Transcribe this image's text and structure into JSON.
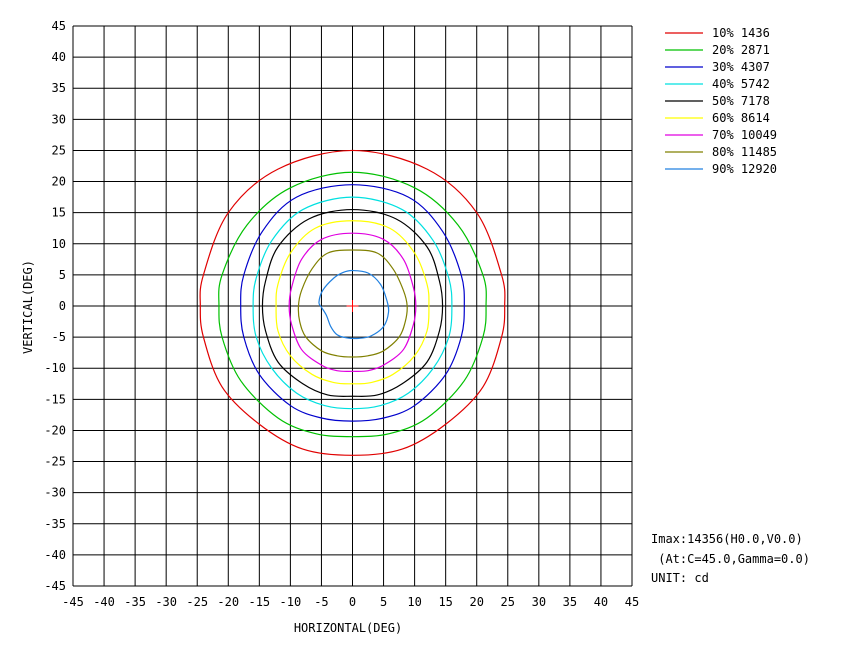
{
  "chart_data": {
    "type": "contour",
    "xlabel": "HORIZONTAL(DEG)",
    "ylabel": "VERTICAL(DEG)",
    "xlim": [
      -45,
      45
    ],
    "ylim": [
      -45,
      45
    ],
    "x_ticks": [
      -45,
      -40,
      -35,
      -30,
      -25,
      -20,
      -15,
      -10,
      -5,
      0,
      5,
      10,
      15,
      20,
      25,
      30,
      35,
      40,
      45
    ],
    "y_ticks": [
      45,
      40,
      35,
      30,
      25,
      20,
      15,
      10,
      5,
      0,
      -5,
      -10,
      -15,
      -20,
      -25,
      -30,
      -35,
      -40,
      -45
    ],
    "grid": true,
    "legend_position": "top-right",
    "center_marker": {
      "h": 0,
      "v": 0,
      "color": "#ff0000"
    },
    "series": [
      {
        "name": "10% 1436",
        "color": "#e00000",
        "points": [
          [
            0,
            25
          ],
          [
            12,
            22
          ],
          [
            20,
            15
          ],
          [
            24,
            5
          ],
          [
            24.5,
            0
          ],
          [
            24,
            -5
          ],
          [
            21,
            -13
          ],
          [
            15,
            -19
          ],
          [
            8,
            -23
          ],
          [
            0,
            -24
          ],
          [
            -8,
            -23
          ],
          [
            -15,
            -19
          ],
          [
            -21,
            -13
          ],
          [
            -24,
            -5
          ],
          [
            -24.5,
            0
          ],
          [
            -24,
            5
          ],
          [
            -20,
            15
          ],
          [
            -12,
            22
          ]
        ]
      },
      {
        "name": "20% 2871",
        "color": "#00c000",
        "points": [
          [
            0,
            21.5
          ],
          [
            10,
            19
          ],
          [
            17,
            13
          ],
          [
            21,
            5
          ],
          [
            21.5,
            0
          ],
          [
            21,
            -5
          ],
          [
            18,
            -12
          ],
          [
            12,
            -18
          ],
          [
            6,
            -20.5
          ],
          [
            0,
            -21
          ],
          [
            -6,
            -20.5
          ],
          [
            -12,
            -18
          ],
          [
            -18,
            -12
          ],
          [
            -21,
            -5
          ],
          [
            -21.5,
            0
          ],
          [
            -21,
            5
          ],
          [
            -17,
            13
          ],
          [
            -10,
            19
          ]
        ]
      },
      {
        "name": "30% 4307",
        "color": "#0000cc",
        "points": [
          [
            0,
            19.5
          ],
          [
            9,
            17.5
          ],
          [
            14.5,
            12
          ],
          [
            17.5,
            5
          ],
          [
            18,
            0
          ],
          [
            17.5,
            -5
          ],
          [
            15,
            -11
          ],
          [
            10,
            -16
          ],
          [
            5,
            -18
          ],
          [
            0,
            -18.5
          ],
          [
            -5,
            -18
          ],
          [
            -10,
            -16
          ],
          [
            -15,
            -11
          ],
          [
            -17.5,
            -5
          ],
          [
            -18,
            0
          ],
          [
            -17.5,
            5
          ],
          [
            -14.5,
            12
          ],
          [
            -9,
            17.5
          ]
        ]
      },
      {
        "name": "40% 5742",
        "color": "#00e0e0",
        "points": [
          [
            0,
            17.5
          ],
          [
            8,
            15.5
          ],
          [
            13,
            10.5
          ],
          [
            15.5,
            4.5
          ],
          [
            16,
            0
          ],
          [
            15.5,
            -5
          ],
          [
            13,
            -10
          ],
          [
            9,
            -14
          ],
          [
            4.5,
            -16
          ],
          [
            0,
            -16.5
          ],
          [
            -4.5,
            -16
          ],
          [
            -9,
            -14
          ],
          [
            -13,
            -10
          ],
          [
            -15.5,
            -5
          ],
          [
            -16,
            0
          ],
          [
            -15.5,
            4.5
          ],
          [
            -13,
            10.5
          ],
          [
            -8,
            15.5
          ]
        ]
      },
      {
        "name": "50% 7178",
        "color": "#000000",
        "points": [
          [
            0,
            15.5
          ],
          [
            7,
            14
          ],
          [
            12,
            9.5
          ],
          [
            14,
            4
          ],
          [
            14.5,
            0
          ],
          [
            14,
            -4
          ],
          [
            12,
            -9
          ],
          [
            8,
            -12.5
          ],
          [
            4,
            -14.3
          ],
          [
            0,
            -14.5
          ],
          [
            -4,
            -14.3
          ],
          [
            -8,
            -12.5
          ],
          [
            -12,
            -9
          ],
          [
            -14,
            -4
          ],
          [
            -14.5,
            0
          ],
          [
            -14,
            4
          ],
          [
            -12,
            9.5
          ],
          [
            -7,
            14
          ]
        ]
      },
      {
        "name": "60% 8614",
        "color": "#ffff00",
        "points": [
          [
            0,
            13.7
          ],
          [
            6,
            12.5
          ],
          [
            10,
            8.5
          ],
          [
            12,
            3.5
          ],
          [
            12.3,
            0
          ],
          [
            12,
            -4
          ],
          [
            10,
            -8
          ],
          [
            6.5,
            -11
          ],
          [
            3,
            -12.3
          ],
          [
            0,
            -12.5
          ],
          [
            -3,
            -12.3
          ],
          [
            -6.5,
            -11
          ],
          [
            -10,
            -8
          ],
          [
            -12,
            -4
          ],
          [
            -12.3,
            0
          ],
          [
            -12,
            3.5
          ],
          [
            -10,
            8.5
          ],
          [
            -6,
            12.5
          ]
        ]
      },
      {
        "name": "70% 10049",
        "color": "#e000e0",
        "points": [
          [
            0,
            11.7
          ],
          [
            5,
            10.7
          ],
          [
            8.2,
            7.5
          ],
          [
            9.8,
            3
          ],
          [
            10.2,
            0
          ],
          [
            9.8,
            -3
          ],
          [
            8.2,
            -7
          ],
          [
            5,
            -9.5
          ],
          [
            2.5,
            -10.4
          ],
          [
            0,
            -10.5
          ],
          [
            -2.5,
            -10.4
          ],
          [
            -5,
            -9.5
          ],
          [
            -8.2,
            -7
          ],
          [
            -9.8,
            -3
          ],
          [
            -10.2,
            0
          ],
          [
            -9.8,
            3
          ],
          [
            -8.2,
            7.5
          ],
          [
            -5,
            10.7
          ]
        ]
      },
      {
        "name": "80% 11485",
        "color": "#808000",
        "points": [
          [
            0,
            9
          ],
          [
            4,
            8.5
          ],
          [
            6.5,
            6
          ],
          [
            8.2,
            2.5
          ],
          [
            8.8,
            0
          ],
          [
            8.5,
            -2.5
          ],
          [
            7.5,
            -5
          ],
          [
            5,
            -7.2
          ],
          [
            2.5,
            -8
          ],
          [
            0,
            -8.2
          ],
          [
            -2.5,
            -8
          ],
          [
            -5,
            -7.2
          ],
          [
            -7.5,
            -5
          ],
          [
            -8.5,
            -2.5
          ],
          [
            -8.7,
            0
          ],
          [
            -8.2,
            2.5
          ],
          [
            -6.5,
            6
          ],
          [
            -4,
            8.5
          ]
        ]
      },
      {
        "name": "90% 12920",
        "color": "#2080e0",
        "points": [
          [
            0,
            5.7
          ],
          [
            2.5,
            5.3
          ],
          [
            4.5,
            3.5
          ],
          [
            5.5,
            1
          ],
          [
            5.8,
            -1
          ],
          [
            5,
            -3.3
          ],
          [
            3,
            -4.8
          ],
          [
            1,
            -5.2
          ],
          [
            -1,
            -5.1
          ],
          [
            -2.5,
            -4.6
          ],
          [
            -3.5,
            -3.3
          ],
          [
            -4.2,
            -1.5
          ],
          [
            -5,
            -0.2
          ],
          [
            -5.4,
            0.6
          ],
          [
            -4.8,
            2.5
          ],
          [
            -3,
            4.5
          ],
          [
            -1.5,
            5.4
          ]
        ]
      }
    ]
  },
  "info": {
    "line1": "Imax:14356(H0.0,V0.0)",
    "line2": " (At:C=45.0,Gamma=0.0)",
    "line3": "UNIT: cd"
  }
}
